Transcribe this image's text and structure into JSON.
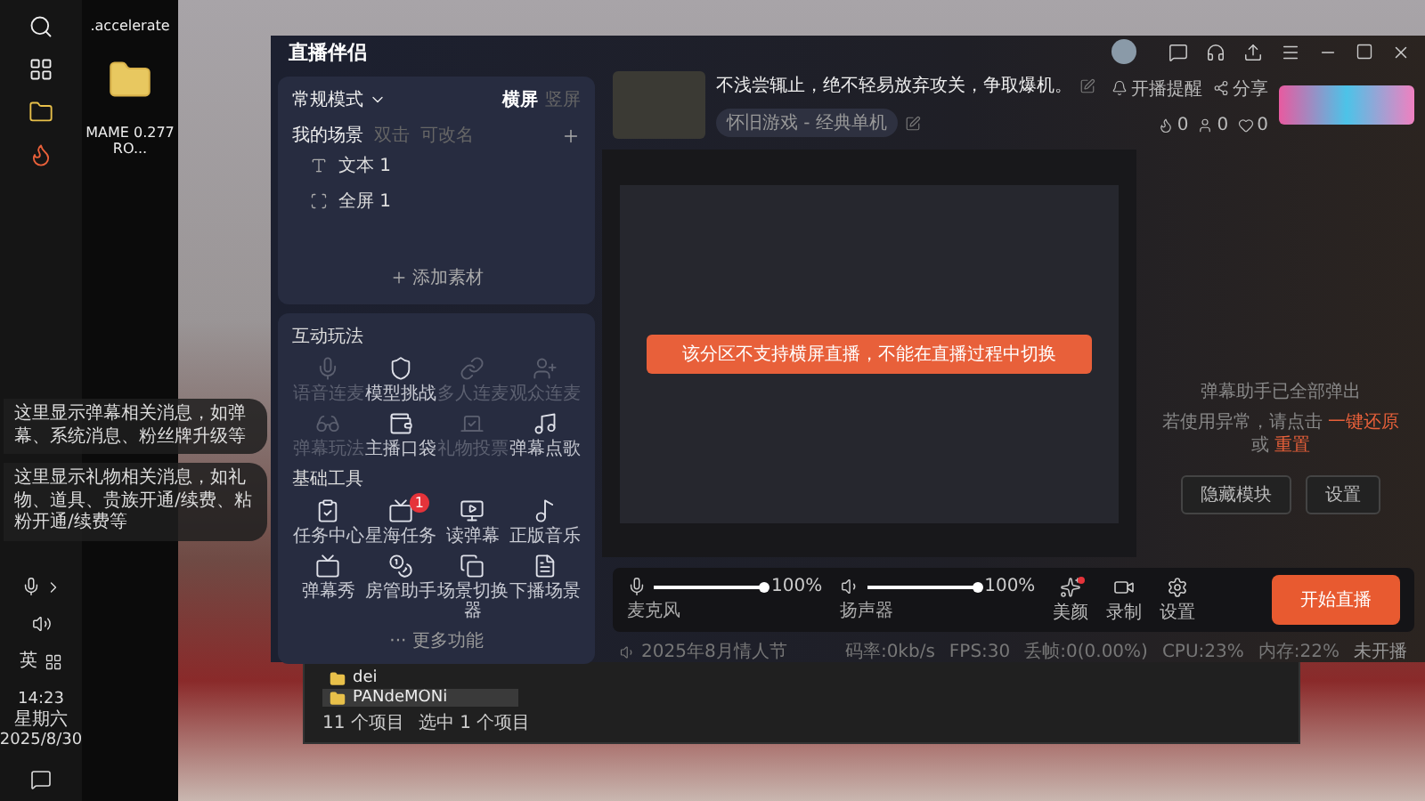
{
  "taskbar": {
    "ime_label": "英",
    "time": "14:23",
    "weekday": "星期六",
    "date": "2025/8/30"
  },
  "desktop_icons": [
    {
      "label": ".accelerate"
    },
    {
      "label": "MAME 0.277 RO..."
    }
  ],
  "overlay_messages": [
    {
      "text": "这里显示弹幕相关消息，如弹幕、系统消息、粉丝牌升级等"
    },
    {
      "text": "这里显示礼物相关消息，如礼物、道具、贵族开通/续费、粘粉开通/续费等"
    }
  ],
  "explorer": {
    "files": [
      {
        "name": "dei",
        "selected": false
      },
      {
        "name": "PANdeMONi",
        "selected": true
      }
    ],
    "status": [
      "11 个项目",
      "选中 1 个项目"
    ]
  },
  "app": {
    "logo": "直播伴侣",
    "scene_panel": {
      "mode": "常规模式",
      "orientations": [
        {
          "label": "横屏",
          "selected": true
        },
        {
          "label": "竖屏",
          "selected": false
        }
      ],
      "title": "我的场景",
      "hints": [
        "双击",
        "可改名"
      ],
      "scenes": [
        {
          "kind": "text",
          "name": "文本 1"
        },
        {
          "kind": "fullscreen",
          "name": "全屏 1"
        }
      ],
      "add_button": "添加素材"
    },
    "interactive": {
      "title": "互动玩法",
      "items": [
        {
          "label": "语音连麦",
          "disabled": true
        },
        {
          "label": "模型挑战",
          "disabled": false
        },
        {
          "label": "多人连麦",
          "disabled": true
        },
        {
          "label": "观众连麦",
          "disabled": true
        },
        {
          "label": "弹幕玩法",
          "disabled": true
        },
        {
          "label": "主播口袋",
          "disabled": false
        },
        {
          "label": "礼物投票",
          "disabled": true
        },
        {
          "label": "弹幕点歌",
          "disabled": false
        }
      ]
    },
    "tools": {
      "title": "基础工具",
      "items": [
        {
          "label": "任务中心"
        },
        {
          "label": "星海任务",
          "badge": "1"
        },
        {
          "label": "读弹幕"
        },
        {
          "label": "正版音乐"
        },
        {
          "label": "弹幕秀"
        },
        {
          "label": "房管助手"
        },
        {
          "label": "场景切换器"
        },
        {
          "label": "下播场景"
        }
      ],
      "more": "··· 更多功能"
    },
    "header": {
      "title": "不浅尝辄止，绝不轻易放弃攻关，争取爆机。",
      "category": "怀旧游戏 - 经典单机",
      "actions": [
        "开播提醒",
        "分享"
      ],
      "stats": [
        "0",
        "0",
        "0"
      ]
    },
    "preview": {
      "toast": "该分区不支持横屏直播，不能在直播过程中切换"
    },
    "danmaku_panel": {
      "notice": "弹幕助手已全部弹出",
      "hint_prefix": "若使用异常，请点击",
      "links": [
        "一键还原",
        "重置"
      ],
      "hint_join": "或",
      "buttons": [
        "隐藏模块",
        "设置"
      ]
    },
    "controls": {
      "audio": [
        {
          "kind": "mic",
          "label": "麦克风",
          "level": 1,
          "reading": "100%"
        },
        {
          "kind": "speaker",
          "label": "扬声器",
          "level": 1,
          "reading": "100%"
        }
      ],
      "tools": [
        {
          "kind": "beauty",
          "label": "美颜",
          "dot": true
        },
        {
          "kind": "record",
          "label": "录制",
          "dot": false
        },
        {
          "kind": "settings",
          "label": "设置",
          "dot": false
        }
      ],
      "start_button": "开始直播"
    },
    "status_bar": {
      "event": "2025年8月情人节",
      "stats": [
        "码率:0kb/s",
        "FPS:30",
        "丢帧:0(0.00%)",
        "CPU:23%",
        "内存:22%"
      ],
      "live_state": "未开播"
    }
  }
}
